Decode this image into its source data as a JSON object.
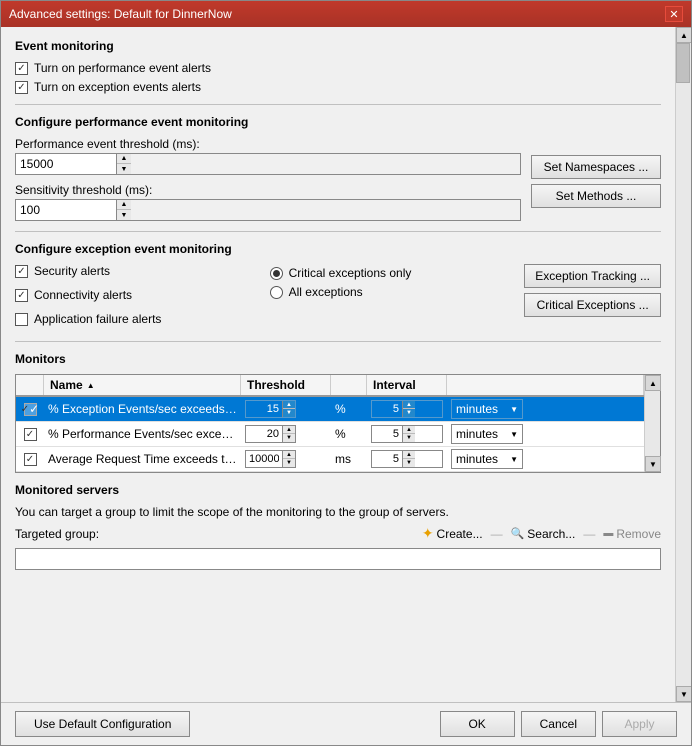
{
  "window": {
    "title": "Advanced settings: Default for DinnerNow",
    "close_label": "✕"
  },
  "event_monitoring": {
    "section_title": "Event monitoring",
    "checkbox1_label": "Turn on performance event alerts",
    "checkbox1_checked": true,
    "checkbox2_label": "Turn on exception events alerts",
    "checkbox2_checked": true
  },
  "perf_monitoring": {
    "section_title": "Configure performance event monitoring",
    "threshold_label": "Performance event threshold (ms):",
    "threshold_value": "15000",
    "sensitivity_label": "Sensitivity threshold (ms):",
    "sensitivity_value": "100",
    "btn_namespaces": "Set Namespaces ...",
    "btn_methods": "Set Methods ..."
  },
  "exception_monitoring": {
    "section_title": "Configure exception event monitoring",
    "checkbox_security_label": "Security alerts",
    "checkbox_security_checked": true,
    "checkbox_connectivity_label": "Connectivity alerts",
    "checkbox_connectivity_checked": true,
    "checkbox_appfailure_label": "Application failure alerts",
    "checkbox_appfailure_checked": false,
    "radio_critical_label": "Critical exceptions only",
    "radio_critical_selected": true,
    "radio_all_label": "All exceptions",
    "radio_all_selected": false,
    "btn_exception_tracking": "Exception Tracking ...",
    "btn_critical_exceptions": "Critical Exceptions ..."
  },
  "monitors": {
    "section_title": "Monitors",
    "columns": [
      "",
      "Name",
      "Threshold",
      "",
      "Interval",
      ""
    ],
    "rows": [
      {
        "checked": true,
        "name": "% Exception Events/sec exceeds ...",
        "threshold": "15",
        "unit": "%",
        "interval": "5",
        "interval_unit": "minutes",
        "selected": true
      },
      {
        "checked": true,
        "name": "% Performance Events/sec excee...",
        "threshold": "20",
        "unit": "%",
        "interval": "5",
        "interval_unit": "minutes",
        "selected": false
      },
      {
        "checked": true,
        "name": "Average Request Time exceeds th...",
        "threshold": "10000",
        "unit": "ms",
        "interval": "5",
        "interval_unit": "minutes",
        "selected": false
      }
    ]
  },
  "monitored_servers": {
    "section_title": "Monitored servers",
    "description": "You can target a group to limit the scope of the monitoring to the group of servers.",
    "targeted_group_label": "Targeted group:",
    "targeted_group_value": "",
    "btn_create": "Create...",
    "btn_search": "Search...",
    "btn_remove": "Remove"
  },
  "footer": {
    "btn_default": "Use Default Configuration",
    "btn_ok": "OK",
    "btn_cancel": "Cancel",
    "btn_apply": "Apply"
  }
}
